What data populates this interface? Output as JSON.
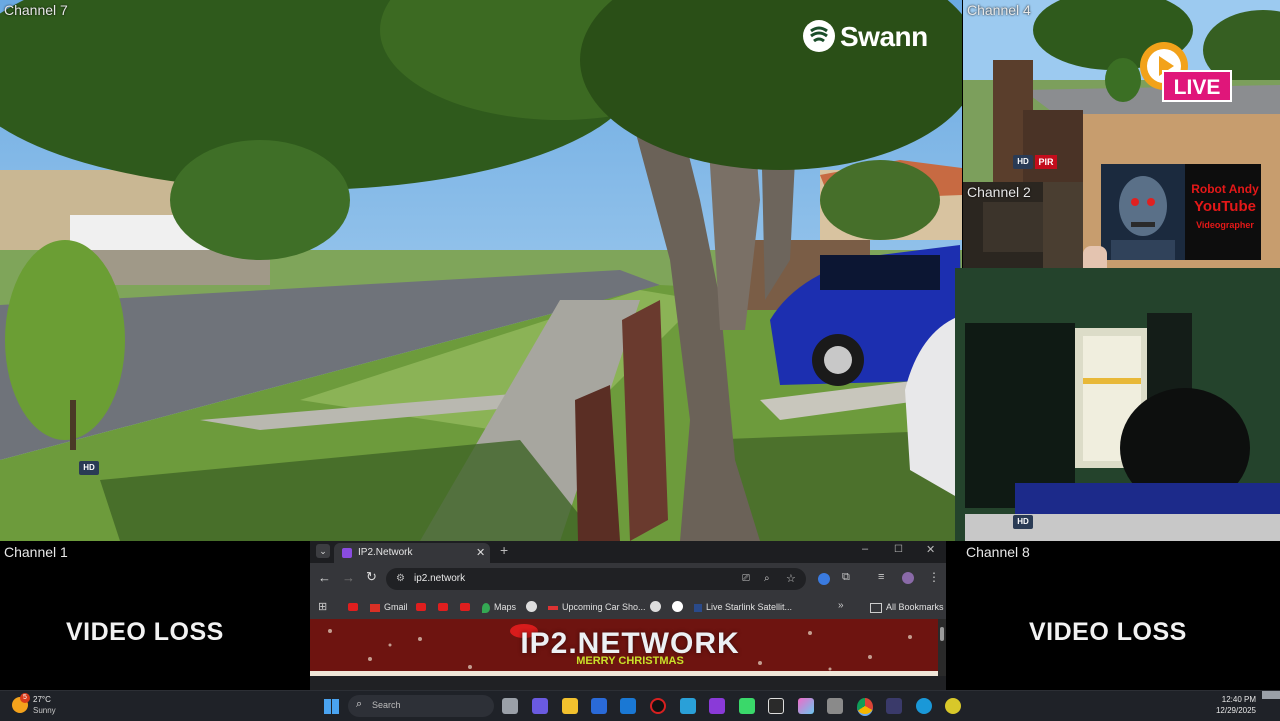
{
  "channels": {
    "ch7": {
      "label": "Channel 7"
    },
    "ch4": {
      "label": "Channel 4"
    },
    "ch2": {
      "label": "Channel 2"
    },
    "ch1": {
      "label": "Channel 1",
      "status": "VIDEO LOSS"
    },
    "ch8": {
      "label": "Channel 8",
      "status": "VIDEO LOSS"
    }
  },
  "overlay": {
    "brand": "Swann",
    "live_label": "LIVE",
    "promo_line1": "Robot Andy",
    "promo_line2": "YouTube",
    "promo_line3": "Videographer"
  },
  "badges": {
    "hd": "HD",
    "pir": "PIR"
  },
  "browser": {
    "tab_title": "IP2.Network",
    "address": "ip2.network",
    "bookmarks": [
      "Gmail",
      "Maps",
      "Upcoming Car Sho...",
      "Live Starlink Satellit...",
      "All Bookmarks"
    ],
    "banner_title": "IP2.NETWORK",
    "banner_subtitle": "MERRY CHRISTMAS"
  },
  "taskbar": {
    "weather_temp": "27°C",
    "weather_desc": "Sunny",
    "notif_count": "5",
    "search_placeholder": "Search",
    "time": "12:40 PM",
    "date": "12/29/2025"
  },
  "colors": {
    "sky": "#7fb8e8",
    "grass": "#6a9a3a",
    "road": "#6f737a",
    "car_blue": "#1c2fb0",
    "live_pink": "#e0167a",
    "promo_red": "#cc1111"
  }
}
